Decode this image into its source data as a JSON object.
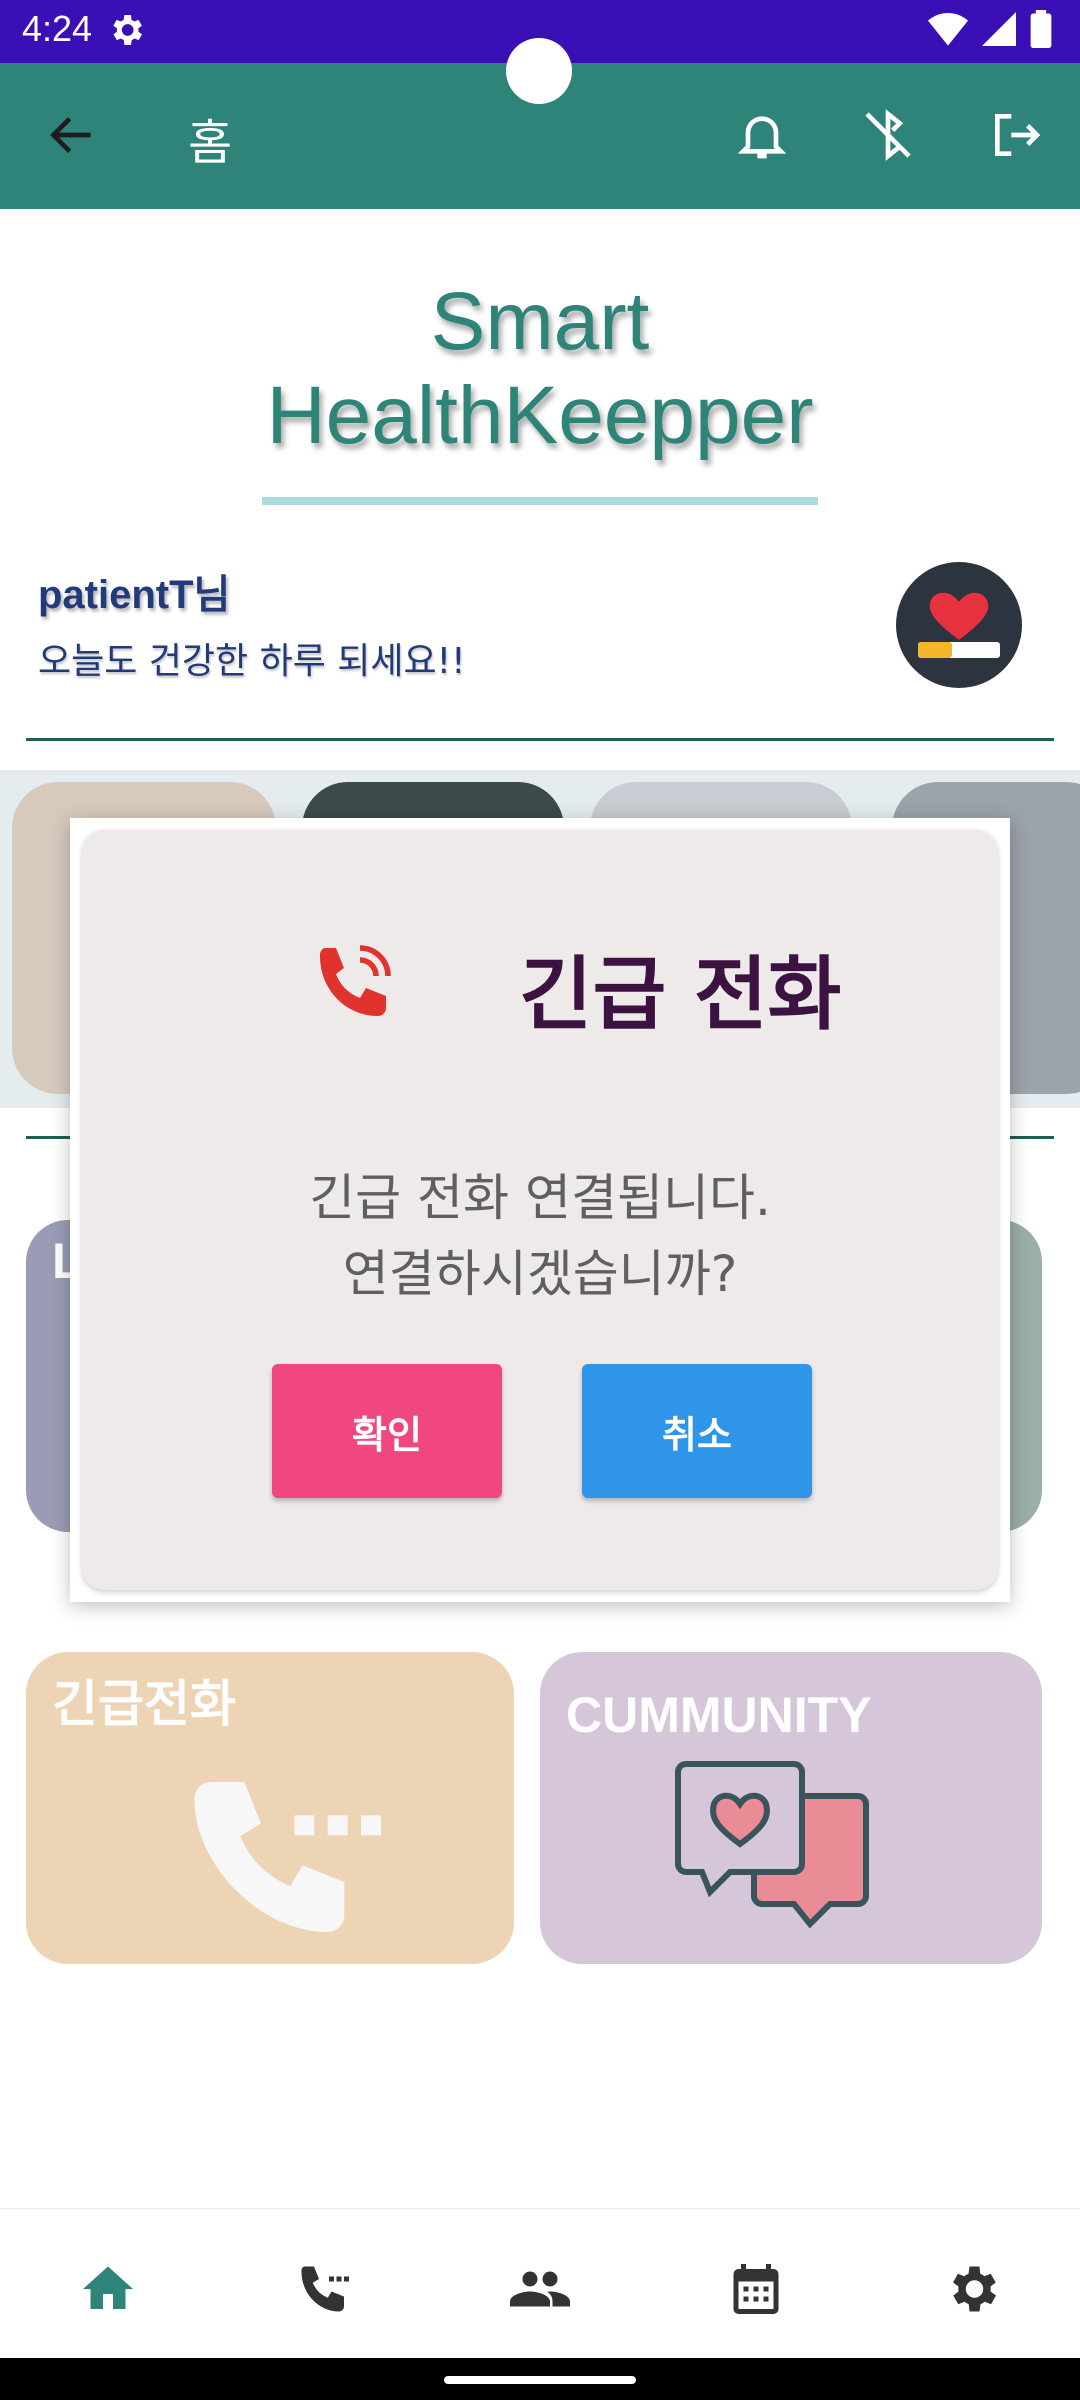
{
  "status_bar": {
    "time": "4:24"
  },
  "app_bar": {
    "title": "홈"
  },
  "brand": {
    "line1": "Smart",
    "line2": "HealthKeepper"
  },
  "greeting": {
    "name": "patientT님",
    "message": "오늘도 건강한 하루 되세요!!"
  },
  "menu": {
    "emergency_label": "긴급전화",
    "community_label": "CUMMUNITY",
    "partial_label": "L"
  },
  "dialog": {
    "title": "긴급 전화",
    "message_line1": "긴급 전화 연결됩니다.",
    "message_line2": "연결하시겠습니까?",
    "confirm_label": "확인",
    "cancel_label": "취소"
  },
  "colors": {
    "status_bar": "#3a0fb5",
    "app_bar": "#2e8478",
    "confirm_button": "#f0477f",
    "cancel_button": "#2f95e8",
    "nav_active": "#2e8478"
  },
  "bottom_nav": {
    "items": [
      "home-icon",
      "phone-icon",
      "people-icon",
      "calendar-icon",
      "settings-icon"
    ],
    "active": "home-icon"
  }
}
